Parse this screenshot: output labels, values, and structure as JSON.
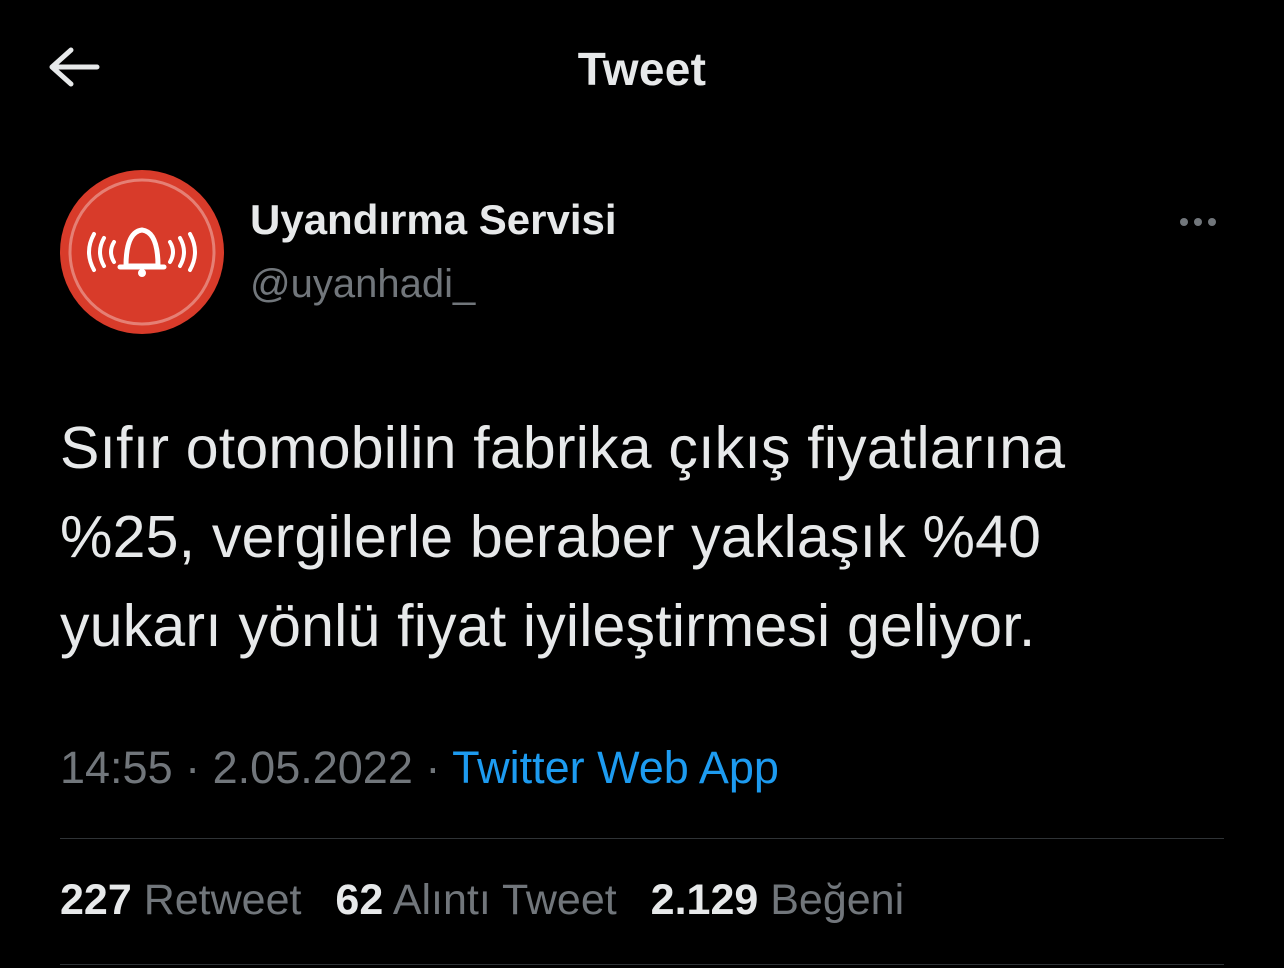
{
  "header": {
    "title": "Tweet",
    "back_icon": "arrow-left-icon"
  },
  "author": {
    "name": "Uyandırma Servisi",
    "handle": "@uyanhadi_",
    "avatar_icon": "alarm-bell-icon",
    "avatar_color": "#d83b2a"
  },
  "more_icon": "more-dots-icon",
  "tweet": {
    "lines": [
      "Sıfır otomobilin fabrika çıkış fiyatlarına",
      "%25, vergilerle beraber yaklaşık %40",
      "yukarı yönlü fiyat iyileştirmesi geliyor."
    ]
  },
  "meta": {
    "time": "14:55",
    "separator": "·",
    "date": "2.05.2022",
    "source": "Twitter Web App"
  },
  "stats": {
    "retweets": {
      "count": "227",
      "label": "Retweet"
    },
    "quotes": {
      "count": "62",
      "label": "Alıntı Tweet"
    },
    "likes": {
      "count": "2.129",
      "label": "Beğeni"
    }
  },
  "colors": {
    "background": "#000000",
    "text": "#e7e9ea",
    "secondary": "#71767b",
    "link": "#1d9bf0",
    "divider": "#2f3336"
  }
}
